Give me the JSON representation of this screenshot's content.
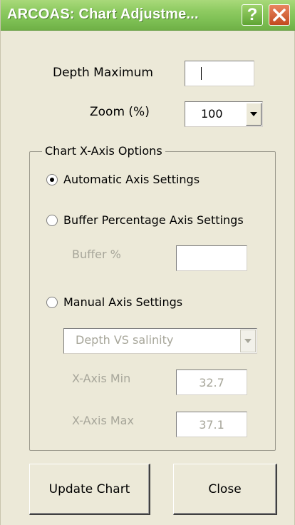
{
  "window": {
    "title": "ARCOAS: Chart Adjustme..."
  },
  "titlebar": {
    "help_symbol": "?",
    "close_symbol": "✕"
  },
  "depth": {
    "label": "Depth Maximum",
    "value": ""
  },
  "zoom": {
    "label": "Zoom (%)",
    "selected": "100"
  },
  "xaxis_group": {
    "title": "Chart X-Axis Options",
    "auto_label": "Automatic Axis Settings",
    "buffer_label": "Buffer Percentage Axis Settings",
    "buffer_pct_label": "Buffer %",
    "buffer_pct_value": "",
    "manual_label": "Manual Axis Settings",
    "chart_select": "Depth VS salinity",
    "xmin_label": "X-Axis Min",
    "xmin_value": "32.7",
    "xmax_label": "X-Axis Max",
    "xmax_value": "37.1",
    "selected_option": "Automatic Axis Settings"
  },
  "buttons": {
    "update": "Update Chart",
    "close": "Close"
  }
}
